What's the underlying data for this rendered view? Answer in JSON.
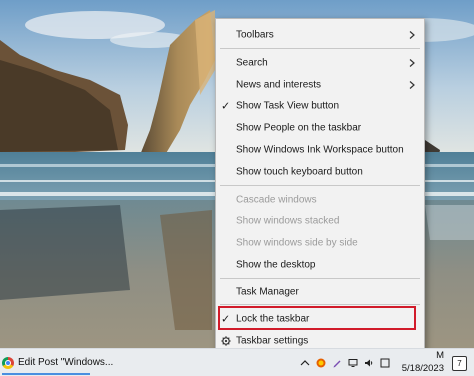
{
  "context_menu": {
    "toolbars": "Toolbars",
    "search": "Search",
    "news_and_interests": "News and interests",
    "show_task_view_button": "Show Task View button",
    "show_people_on_taskbar": "Show People on the taskbar",
    "show_windows_ink_workspace_button": "Show Windows Ink Workspace button",
    "show_touch_keyboard_button": "Show touch keyboard button",
    "cascade_windows": "Cascade windows",
    "show_windows_stacked": "Show windows stacked",
    "show_windows_side_by_side": "Show windows side by side",
    "show_the_desktop": "Show the desktop",
    "task_manager": "Task Manager",
    "lock_the_taskbar": "Lock the taskbar",
    "taskbar_settings": "Taskbar settings",
    "check_mark": "✓",
    "highlight_color": "#d11b2a"
  },
  "taskbar": {
    "app_label": "Edit Post \"Windows...",
    "time_fragment": "M",
    "date": "5/18/2023",
    "notification_count": "7",
    "tray_icons": [
      "chevron-up-icon",
      "firefox-icon",
      "pen-icon",
      "network-icon",
      "volume-icon",
      "ime-icon"
    ]
  }
}
